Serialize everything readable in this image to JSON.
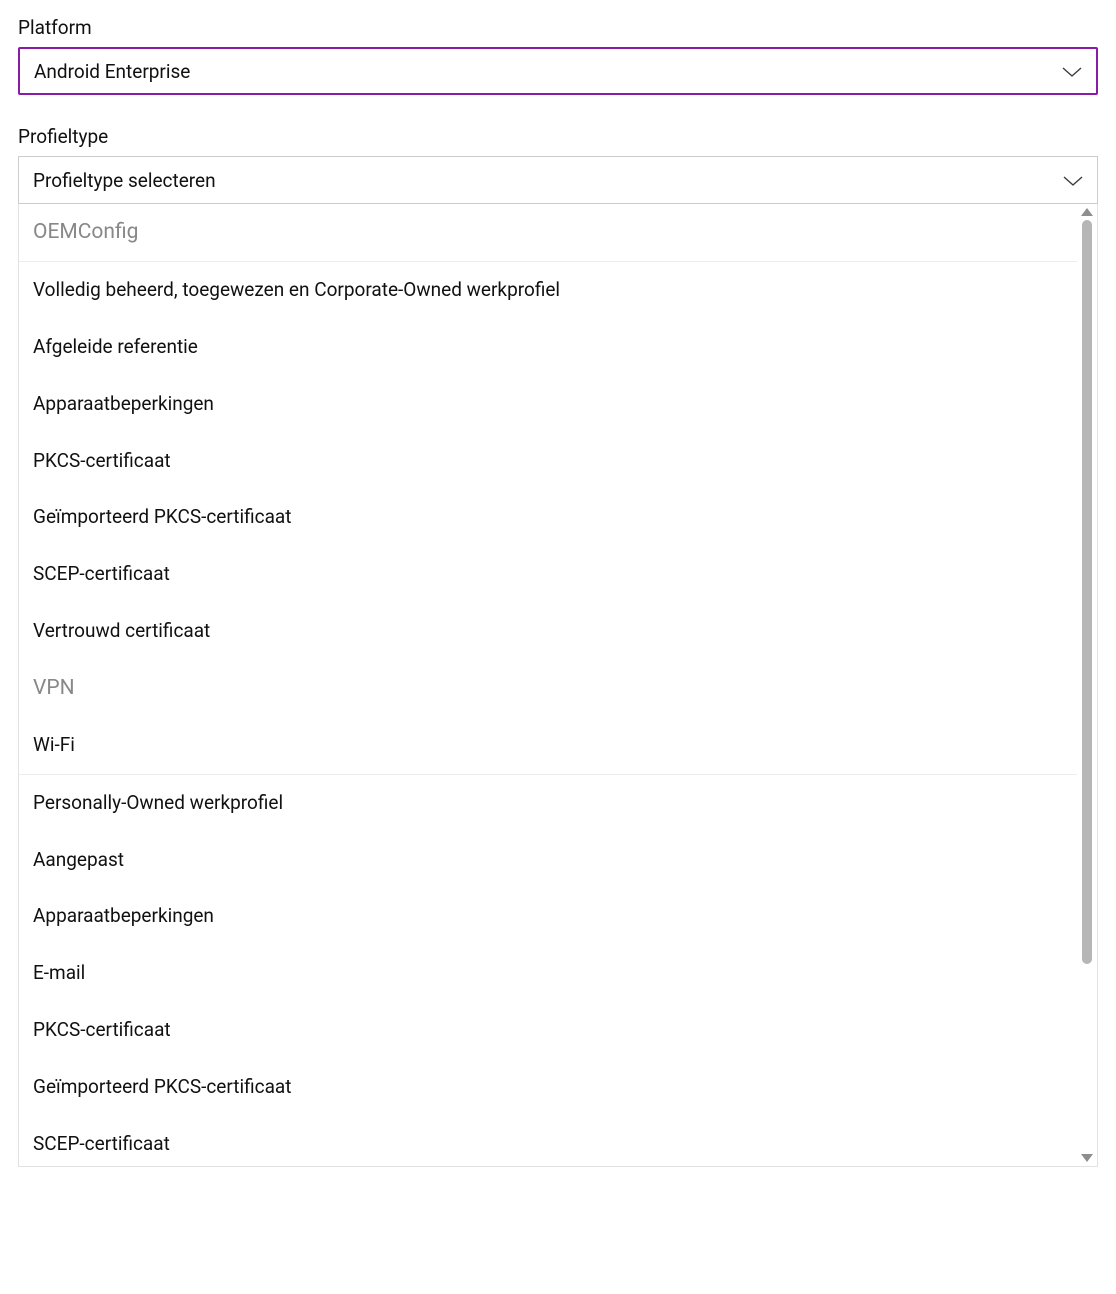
{
  "platform": {
    "label": "Platform",
    "value": "Android Enterprise"
  },
  "profileType": {
    "label": "Profieltype",
    "placeholder": "Profieltype selecteren"
  },
  "dropdown": {
    "entries": [
      {
        "type": "group",
        "text": "OEMConfig"
      },
      {
        "type": "option",
        "text": "Volledig beheerd, toegewezen en Corporate-Owned werkprofiel"
      },
      {
        "type": "option",
        "text": "Afgeleide referentie"
      },
      {
        "type": "option",
        "text": "Apparaatbeperkingen"
      },
      {
        "type": "option",
        "text": "PKCS-certificaat"
      },
      {
        "type": "option",
        "text": "Geïmporteerd PKCS-certificaat"
      },
      {
        "type": "option",
        "text": "SCEP-certificaat"
      },
      {
        "type": "option",
        "text": "Vertrouwd certificaat"
      },
      {
        "type": "group",
        "text": "VPN",
        "noborder": true
      },
      {
        "type": "option",
        "text": "Wi-Fi"
      },
      {
        "type": "sep"
      },
      {
        "type": "option",
        "text": "Personally-Owned werkprofiel"
      },
      {
        "type": "option",
        "text": "Aangepast"
      },
      {
        "type": "option",
        "text": "Apparaatbeperkingen"
      },
      {
        "type": "option",
        "text": "E-mail"
      },
      {
        "type": "option",
        "text": "PKCS-certificaat"
      },
      {
        "type": "option",
        "text": "Geïmporteerd PKCS-certificaat"
      },
      {
        "type": "option",
        "text": "SCEP-certificaat"
      }
    ]
  }
}
